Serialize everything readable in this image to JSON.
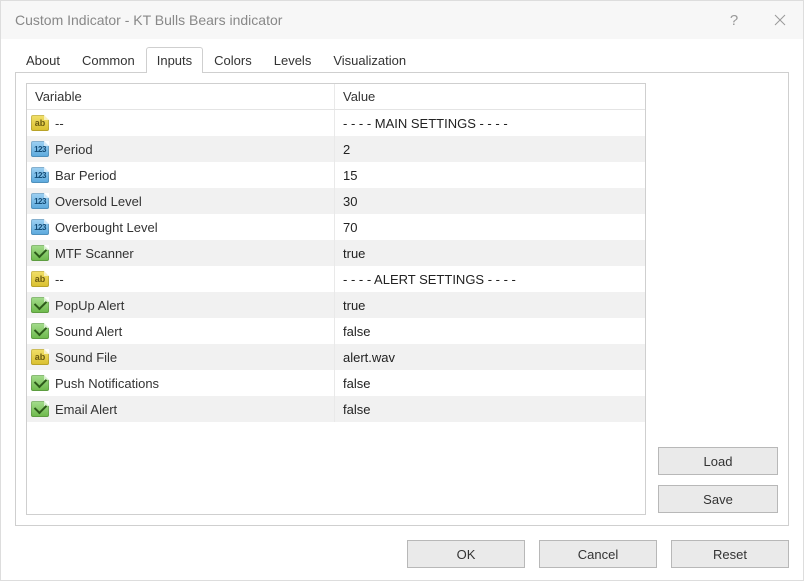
{
  "window": {
    "title": "Custom Indicator - KT Bulls Bears indicator"
  },
  "tabs": {
    "items": [
      {
        "label": "About"
      },
      {
        "label": "Common"
      },
      {
        "label": "Inputs"
      },
      {
        "label": "Colors"
      },
      {
        "label": "Levels"
      },
      {
        "label": "Visualization"
      }
    ],
    "active_index": 2
  },
  "table": {
    "headers": {
      "variable": "Variable",
      "value": "Value"
    },
    "rows": [
      {
        "icon": "ab",
        "variable": "--",
        "value": "- - - - MAIN SETTINGS - - - -"
      },
      {
        "icon": "123",
        "variable": "Period",
        "value": "2"
      },
      {
        "icon": "123",
        "variable": "Bar Period",
        "value": "15"
      },
      {
        "icon": "123",
        "variable": "Oversold Level",
        "value": "30"
      },
      {
        "icon": "123",
        "variable": "Overbought Level",
        "value": "70"
      },
      {
        "icon": "bool",
        "variable": "MTF Scanner",
        "value": "true"
      },
      {
        "icon": "ab",
        "variable": "--",
        "value": "- - - - ALERT SETTINGS - - - -"
      },
      {
        "icon": "bool",
        "variable": "PopUp Alert",
        "value": "true"
      },
      {
        "icon": "bool",
        "variable": "Sound Alert",
        "value": "false"
      },
      {
        "icon": "ab",
        "variable": "Sound File",
        "value": "alert.wav"
      },
      {
        "icon": "bool",
        "variable": "Push Notifications",
        "value": "false"
      },
      {
        "icon": "bool",
        "variable": "Email Alert",
        "value": "false"
      }
    ]
  },
  "buttons": {
    "load": "Load",
    "save": "Save",
    "ok": "OK",
    "cancel": "Cancel",
    "reset": "Reset"
  }
}
